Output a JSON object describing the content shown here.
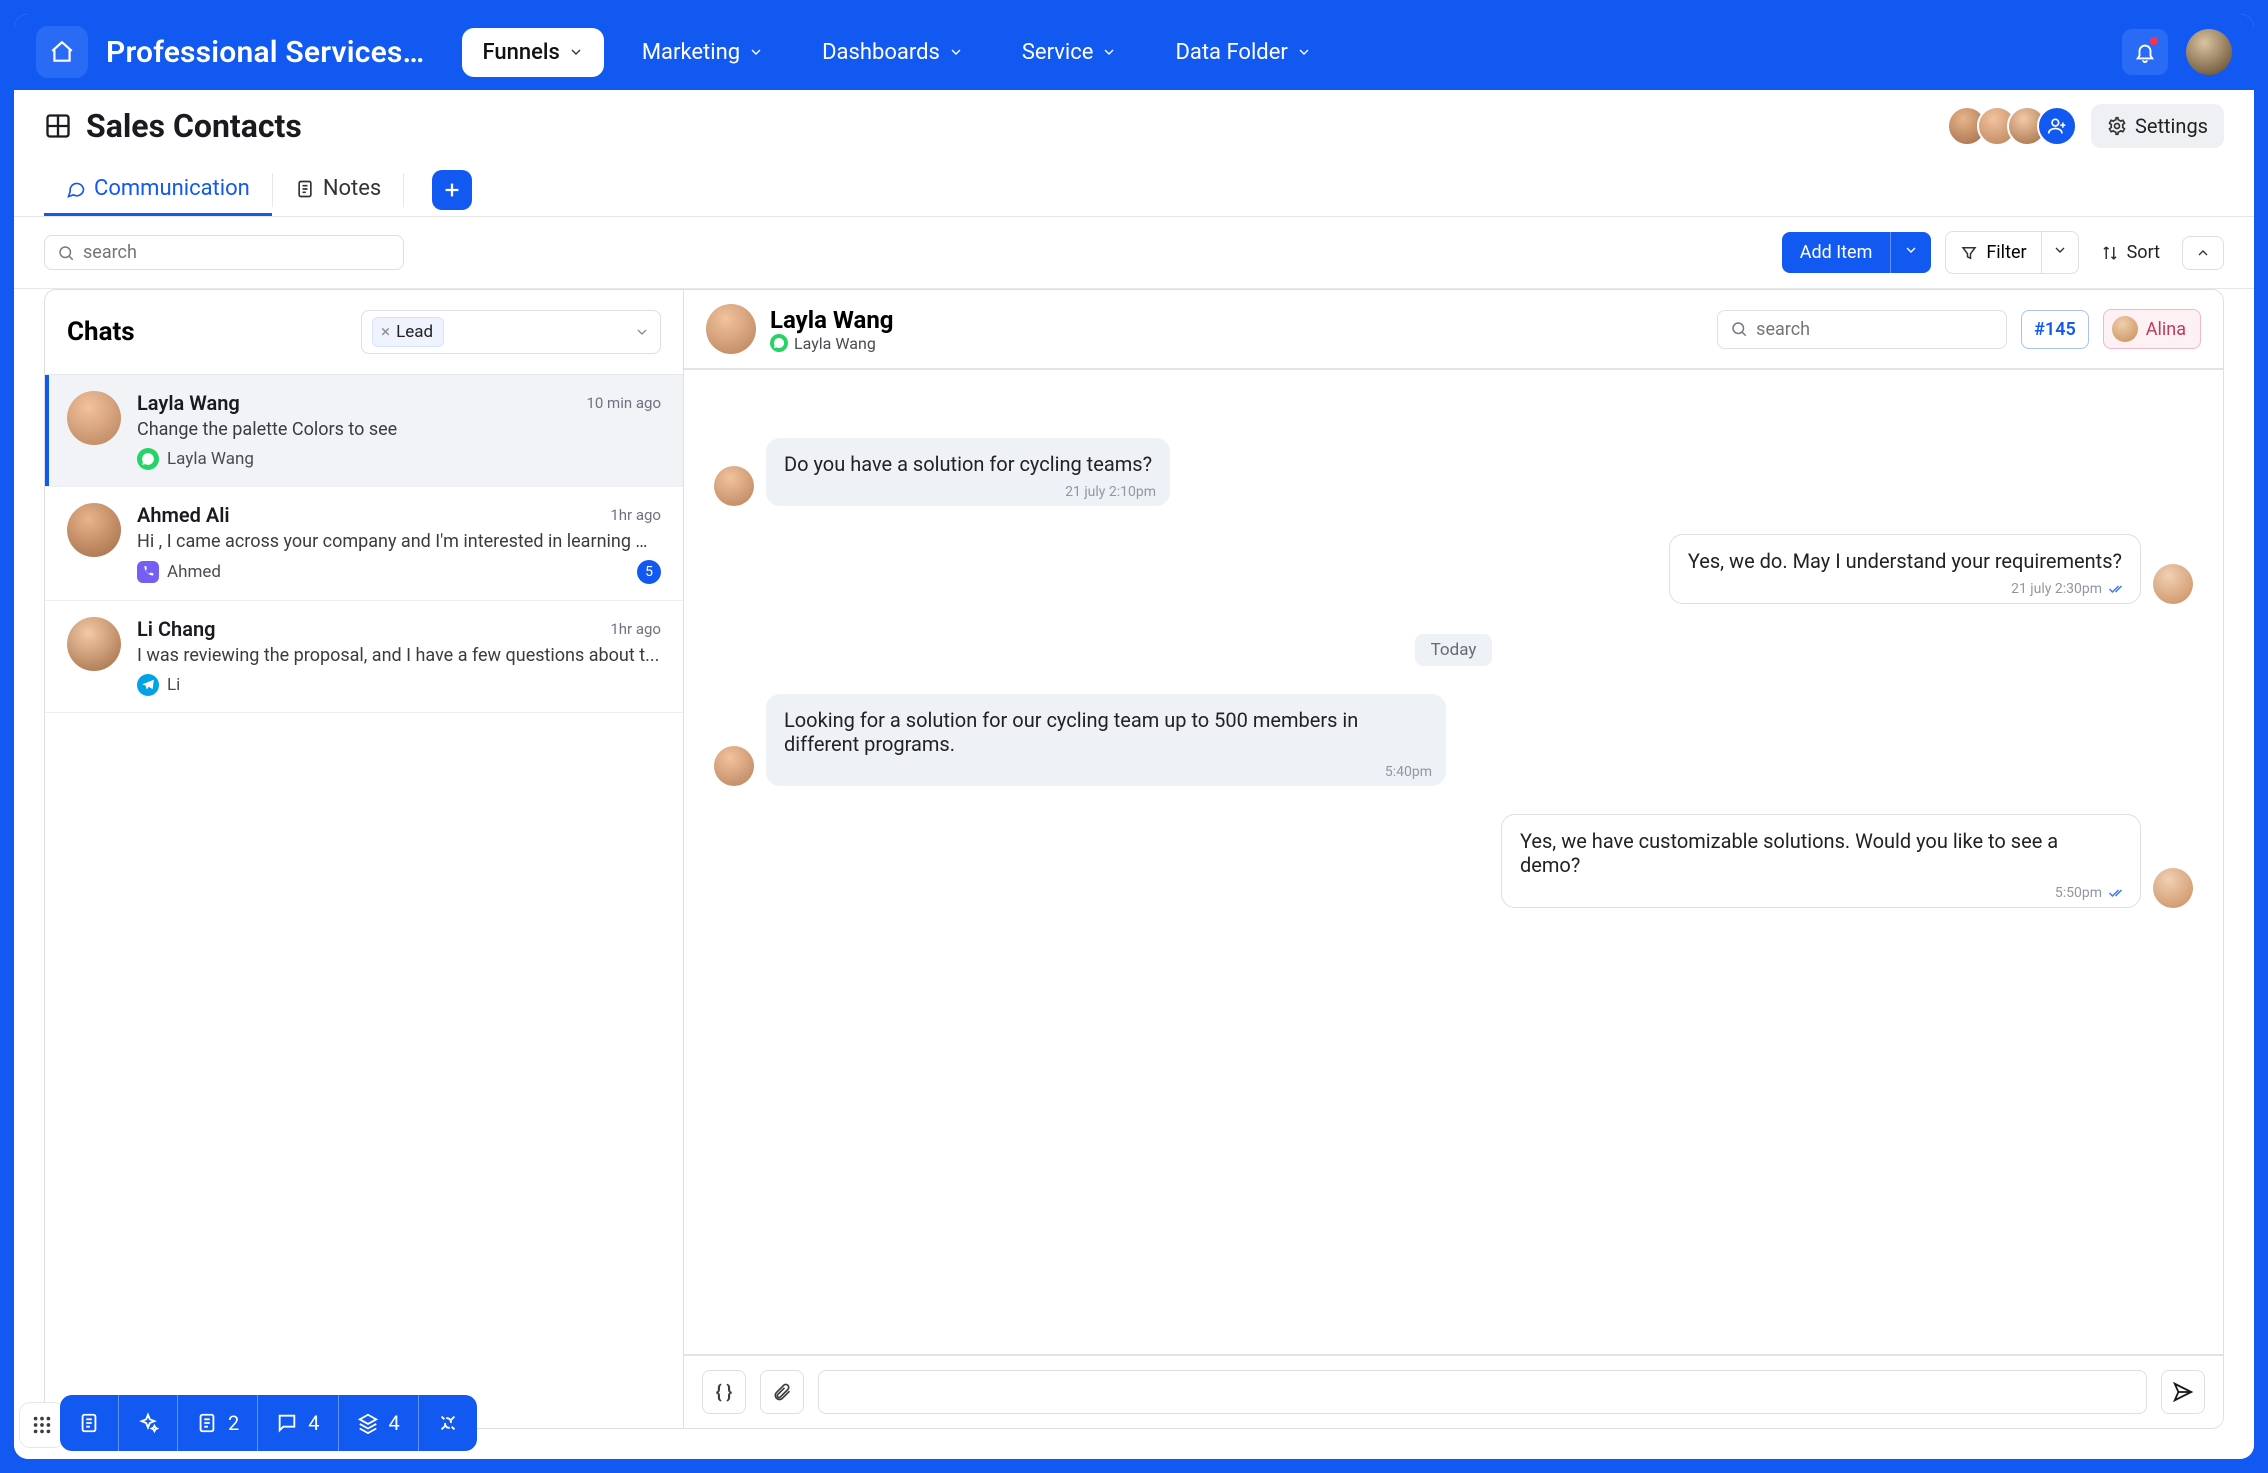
{
  "header": {
    "app_title": "Professional Services…",
    "tabs": [
      {
        "label": "Funnels",
        "active": true
      },
      {
        "label": "Marketing",
        "active": false
      },
      {
        "label": "Dashboards",
        "active": false
      },
      {
        "label": "Service",
        "active": false
      },
      {
        "label": "Data Folder",
        "active": false
      }
    ]
  },
  "page": {
    "title": "Sales Contacts",
    "settings_label": "Settings",
    "tabs": [
      {
        "label": "Communication",
        "active": true
      },
      {
        "label": "Notes",
        "active": false
      }
    ]
  },
  "toolbar": {
    "search_placeholder": "search",
    "add_item_label": "Add Item",
    "filter_label": "Filter",
    "sort_label": "Sort"
  },
  "left_panel": {
    "title": "Chats",
    "filter_chip": "Lead",
    "items": [
      {
        "name": "Layla Wang",
        "preview": "Change the palette Colors to see",
        "time": "10 min ago",
        "source": "whatsapp",
        "source_label": "Layla Wang",
        "selected": true,
        "badge": null
      },
      {
        "name": "Ahmed Ali",
        "preview": "Hi , I came across your company and I'm interested in learning m...",
        "time": "1hr ago",
        "source": "viber",
        "source_label": "Ahmed",
        "selected": false,
        "badge": "5"
      },
      {
        "name": "Li Chang",
        "preview": "I was reviewing the proposal, and I have a few questions about t...",
        "time": "1hr ago",
        "source": "telegram",
        "source_label": "Li",
        "selected": false,
        "badge": null
      }
    ]
  },
  "conversation": {
    "contact_name": "Layla Wang",
    "contact_sub": "Layla Wang",
    "search_placeholder": "search",
    "ticket_id": "#145",
    "assignee": "Alina",
    "divider": "Today",
    "messages": [
      {
        "side": "left",
        "text": "Do you have a solution for cycling teams?",
        "time": "21 july 2:10pm",
        "read": false
      },
      {
        "side": "right",
        "text": "Yes, we do. May I understand your requirements?",
        "time": "21 july 2:30pm",
        "read": true
      },
      {
        "side": "divider"
      },
      {
        "side": "left",
        "text": "Looking for a solution for our cycling team up to 500 members in different programs.",
        "time": "5:40pm",
        "read": false
      },
      {
        "side": "right",
        "text": "Yes, we have customizable solutions. Would you like to see a demo?",
        "time": "5:50pm",
        "read": true
      }
    ]
  },
  "bottombar": {
    "doc_count": "2",
    "chat_count": "4",
    "layers_count": "4"
  }
}
